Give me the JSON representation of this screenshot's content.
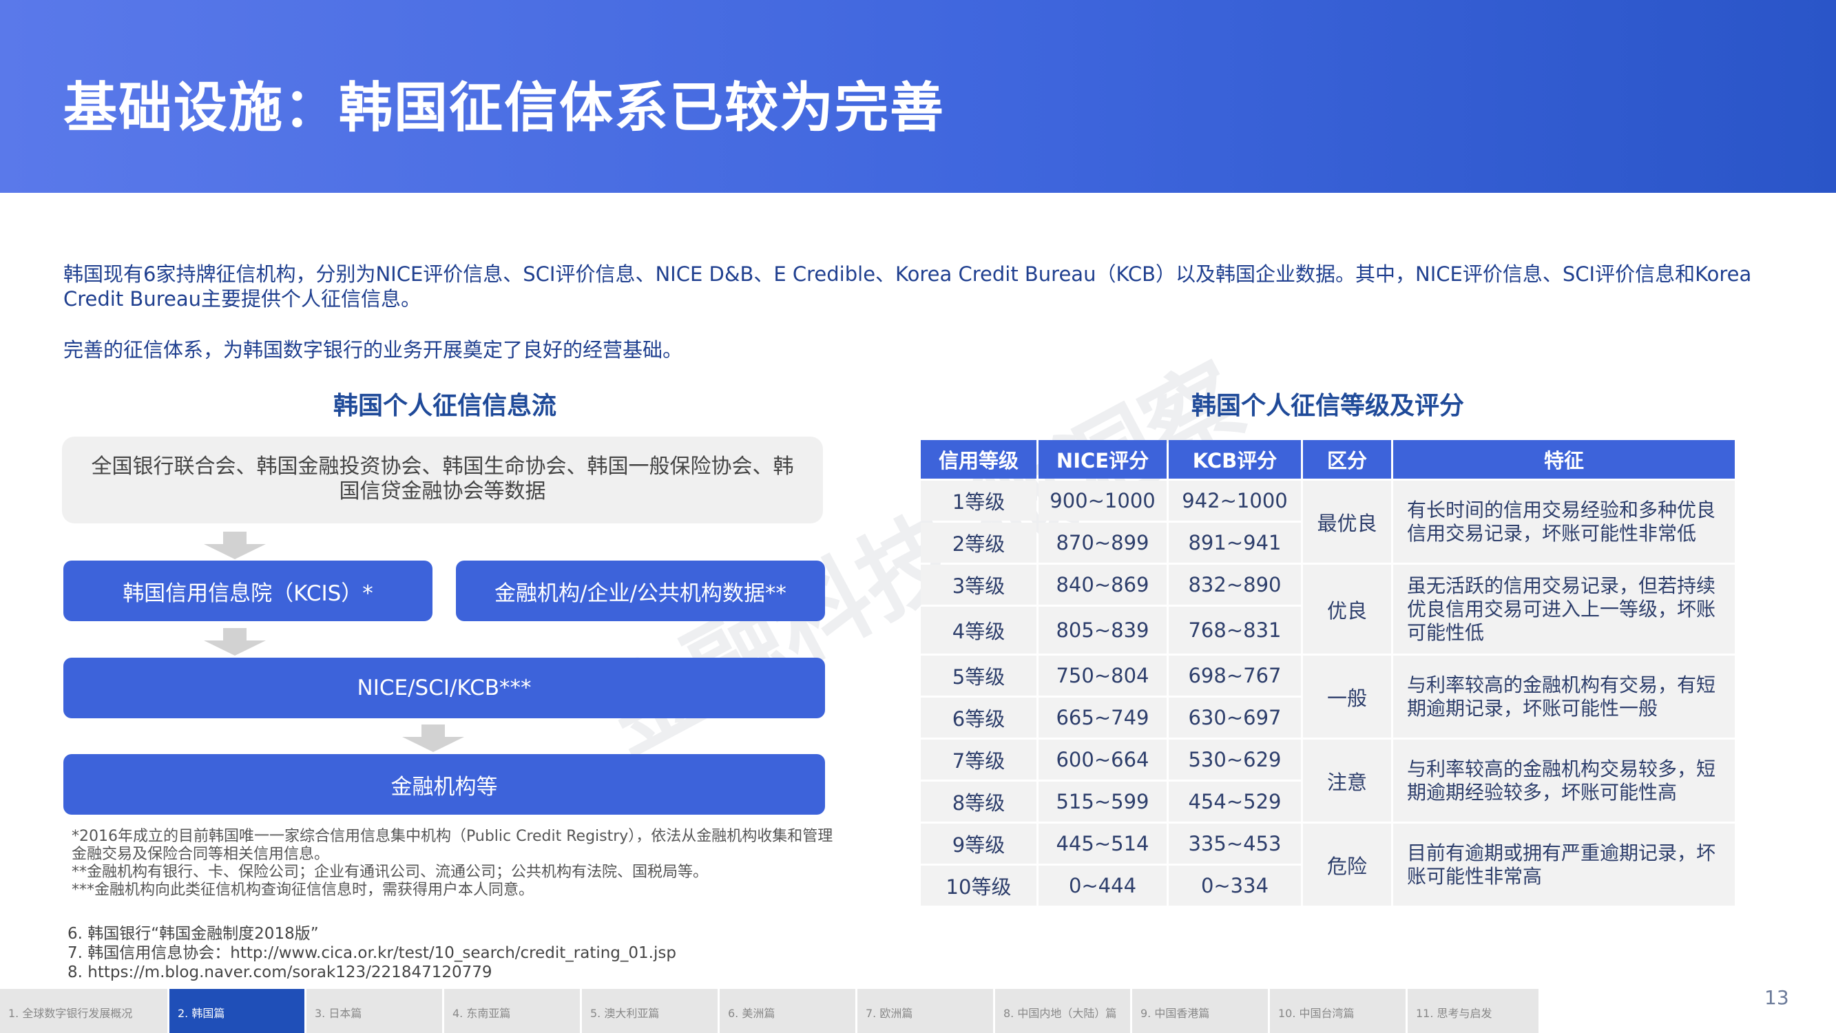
{
  "header": {
    "title": "基础设施：韩国征信体系已较为完善"
  },
  "intro": {
    "p1": "韩国现有6家持牌征信机构，分别为NICE评价信息、SCI评价信息、NICE D&B、E Credible、Korea Credit Bureau（KCB）以及韩国企业数据。其中，NICE评价信息、SCI评价信息和Korea Credit Bureau主要提供个人征信信息。",
    "p2": "完善的征信体系，为韩国数字银行的业务开展奠定了良好的经营基础。"
  },
  "flow": {
    "title": "韩国个人征信信息流",
    "source": "全国银行联合会、韩国金融投资协会、韩国生命协会、韩国一般保险协会、韩国信贷金融协会等数据",
    "box1": "韩国信用信息院（KCIS）*",
    "box2": "金融机构/企业/公共机构数据**",
    "box3": "NICE/SCI/KCB***",
    "box4": "金融机构等",
    "notes": [
      "*2016年成立的目前韩国唯一一家综合信用信息集中机构（Public Credit Registry），依法从金融机构收集和管理金融交易及保险合同等相关信用信息。",
      "**金融机构有银行、卡、保险公司；企业有通讯公司、流通公司；公共机构有法院、国税局等。",
      "***金融机构向此类征信机构查询征信信息时，需获得用户本人同意。"
    ]
  },
  "refs": [
    "6. 韩国银行“韩国金融制度2018版”",
    "7. 韩国信用信息协会：http://www.cica.or.kr/test/10_search/credit_rating_01.jsp",
    "8. https://m.blog.naver.com/sorak123/221847120779"
  ],
  "watermark": "金融科技 微洞察",
  "table": {
    "title": "韩国个人征信等级及评分",
    "headers": [
      "信用等级",
      "NICE评分",
      "KCB评分",
      "区分",
      "特征"
    ],
    "rows": [
      {
        "grade": "1等级",
        "nice": "900~1000",
        "kcb": "942~1000"
      },
      {
        "grade": "2等级",
        "nice": "870~899",
        "kcb": "891~941"
      },
      {
        "grade": "3等级",
        "nice": "840~869",
        "kcb": "832~890"
      },
      {
        "grade": "4等级",
        "nice": "805~839",
        "kcb": "768~831"
      },
      {
        "grade": "5等级",
        "nice": "750~804",
        "kcb": "698~767"
      },
      {
        "grade": "6等级",
        "nice": "665~749",
        "kcb": "630~697"
      },
      {
        "grade": "7等级",
        "nice": "600~664",
        "kcb": "530~629"
      },
      {
        "grade": "8等级",
        "nice": "515~599",
        "kcb": "454~529"
      },
      {
        "grade": "9等级",
        "nice": "445~514",
        "kcb": "335~453"
      },
      {
        "grade": "10等级",
        "nice": "0~444",
        "kcb": "0~334"
      }
    ],
    "groups": [
      {
        "class": "最优良",
        "feature": "有长时间的信用交易经验和多种优良信用交易记录，坏账可能性非常低"
      },
      {
        "class": "优良",
        "feature": "虽无活跃的信用交易记录，但若持续优良信用交易可进入上一等级，坏账可能性低"
      },
      {
        "class": "一般",
        "feature": "与利率较高的金融机构有交易，有短期逾期记录，坏账可能性一般"
      },
      {
        "class": "注意",
        "feature": "与利率较高的金融机构交易较多，短期逾期经验较多，坏账可能性高"
      },
      {
        "class": "危险",
        "feature": "目前有逾期或拥有严重逾期记录，坏账可能性非常高"
      }
    ]
  },
  "nav": {
    "tabs": [
      "1. 全球数字银行发展概况",
      "2. 韩国篇",
      "3. 日本篇",
      "4. 东南亚篇",
      "5. 澳大利亚篇",
      "6. 美洲篇",
      "7. 欧洲篇",
      "8. 中国内地（大陆）篇",
      "9. 中国香港篇",
      "10. 中国台湾篇",
      "11. 思考与启发"
    ]
  },
  "page_number": "13"
}
